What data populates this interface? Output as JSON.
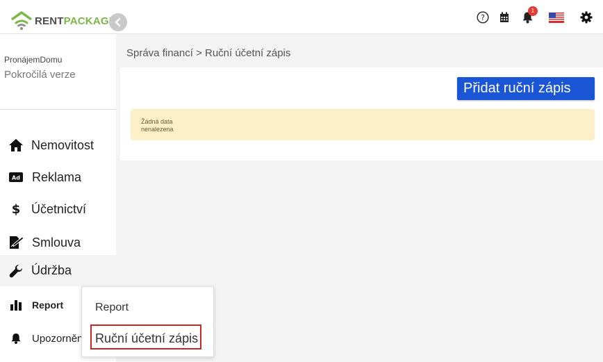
{
  "app": {
    "logo_part1": "RENT",
    "logo_part2": "PACKAGE"
  },
  "header": {
    "notification_count": "1"
  },
  "account": {
    "name": "PronájemDomu",
    "plan": "Pokročilá verze"
  },
  "nav": {
    "items": [
      {
        "label": "Nemovitost",
        "icon": "home-icon"
      },
      {
        "label": "Reklama",
        "icon": "ad-icon"
      },
      {
        "label": "Účetnictví",
        "icon": "dollar-icon"
      },
      {
        "label": "Smlouva",
        "icon": "contract-icon"
      },
      {
        "label": "Údržba",
        "icon": "wrench-icon"
      },
      {
        "label": "Report",
        "icon": "bar-chart-icon"
      },
      {
        "label": "Upozornění",
        "icon": "bell-icon"
      }
    ]
  },
  "breadcrumb": "Správa financí > Ruční účetní zápis",
  "main": {
    "add_button": "Přidat ruční zápis",
    "empty_line1": "Žádná data",
    "empty_line2": "nenalezena"
  },
  "dropdown": {
    "items": [
      "Report",
      "Ruční účetní zápis"
    ]
  },
  "colors": {
    "accent": "#1a55d6",
    "brand_green": "#7ab648",
    "warning_bg": "#fdf0c8",
    "highlight_border": "#c62828"
  }
}
